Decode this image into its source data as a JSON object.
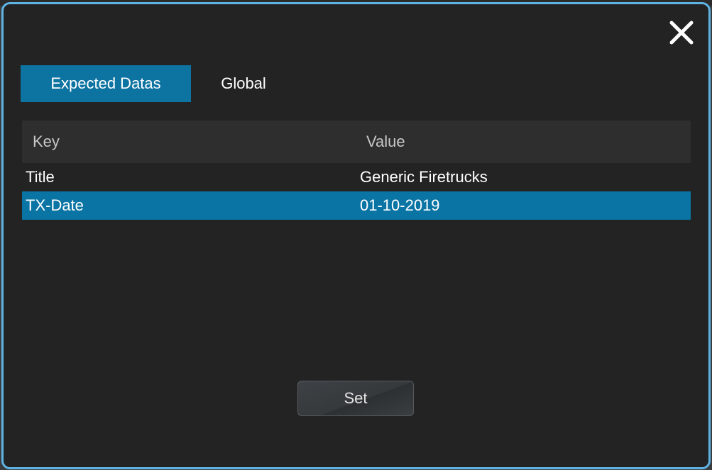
{
  "dialog": {
    "close_icon": "close-icon",
    "accent_color": "#5fb4e4"
  },
  "tabs": [
    {
      "label": "Expected Datas",
      "active": true
    },
    {
      "label": "Global",
      "active": false
    }
  ],
  "grid": {
    "columns": [
      "Key",
      "Value"
    ],
    "rows": [
      {
        "key": "Title",
        "value": "Generic Firetrucks",
        "selected": false
      },
      {
        "key": "TX-Date",
        "value": "01-10-2019",
        "selected": true
      }
    ],
    "selection_color": "#0a74a4"
  },
  "actions": {
    "set_label": "Set"
  }
}
